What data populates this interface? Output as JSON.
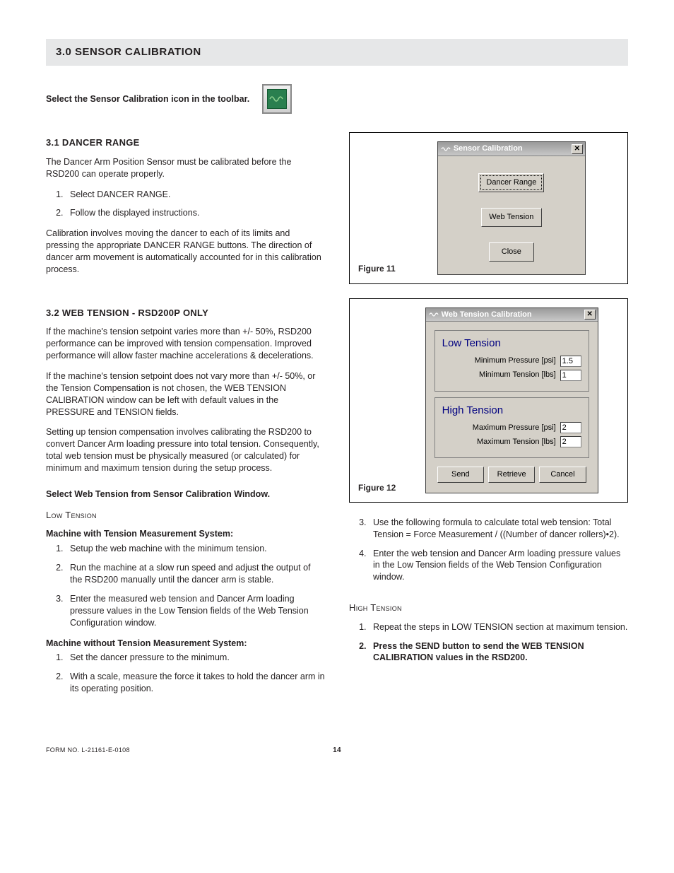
{
  "header": {
    "title": "3.0 SENSOR CALIBRATION"
  },
  "intro": {
    "text": "Select the Sensor Calibration icon in the toolbar."
  },
  "sec31": {
    "title": "3.1 DANCER RANGE",
    "p1": "The Dancer Arm Position Sensor must be calibrated before the RSD200 can operate properly.",
    "steps": [
      "Select DANCER RANGE.",
      "Follow the displayed instructions."
    ],
    "p2": "Calibration involves moving the dancer to each of its limits and pressing the appropriate DANCER RANGE buttons. The direction of dancer arm movement is automatically accounted for in this calibration process."
  },
  "sec32": {
    "title": "3.2 WEB TENSION - RSD200P ONLY",
    "p1": "If the machine's tension setpoint varies more than +/- 50%, RSD200 performance can be improved with tension compensation.  Improved performance will allow faster machine accelerations & decelerations.",
    "p2": "If the machine's tension setpoint does not vary more than +/- 50%, or the Tension Compensation is not chosen, the WEB TENSION CALIBRATION window can be left with default values in the PRESSURE and TENSION fields.",
    "p3": "Setting up tension compensation involves calibrating the RSD200 to convert Dancer Arm loading pressure into total tension. Consequently, total web tension must be physically measured (or calculated) for minimum and maximum tension during the setup process.",
    "select_line": "Select Web Tension from Sensor Calibration Window.",
    "low_heading": "Low Tension",
    "with_heading": "Machine with Tension Measurement System:",
    "with_steps": [
      "Setup the web machine with the minimum tension.",
      "Run the machine at a slow run speed and adjust the output of the RSD200 manually until the dancer arm is stable.",
      "Enter the measured web tension and Dancer Arm loading pressure values in the Low Tension fields of the Web Tension Configuration window."
    ],
    "without_heading": "Machine without Tension Measurement System:",
    "without_steps": [
      "Set the dancer pressure to the minimum.",
      "With a scale, measure the force it takes to hold the dancer arm in its operating position."
    ],
    "without_cont": [
      "Use the following formula to calculate total web tension: Total Tension = Force Measurement / ((Number of dancer rollers)•2).",
      "Enter the web tension and Dancer Arm loading pressure values in the Low Tension fields of the Web Tension Configuration window."
    ],
    "high_heading": "High Tension",
    "high_steps": [
      "Repeat the steps in LOW TENSION section at maximum tension."
    ],
    "high_bold": "Press the SEND button to send the WEB TENSION CALIBRATION values in the RSD200."
  },
  "fig11": {
    "caption": "Figure 11",
    "title": "Sensor Calibration",
    "btn_dancer": "Dancer Range",
    "btn_web": "Web Tension",
    "btn_close": "Close"
  },
  "fig12": {
    "caption": "Figure 12",
    "title": "Web Tension Calibration",
    "low_title": "Low Tension",
    "min_pressure_label": "Minimum Pressure [psi]",
    "min_pressure_value": "1.5",
    "min_tension_label": "Minimum Tension [lbs]",
    "min_tension_value": "1",
    "high_title": "High Tension",
    "max_pressure_label": "Maximum Pressure [psi]",
    "max_pressure_value": "2",
    "max_tension_label": "Maximum Tension [lbs]",
    "max_tension_value": "2",
    "btn_send": "Send",
    "btn_retrieve": "Retrieve",
    "btn_cancel": "Cancel"
  },
  "footer": {
    "form_no": "FORM NO. L-21161-E-0108",
    "page": "14"
  }
}
